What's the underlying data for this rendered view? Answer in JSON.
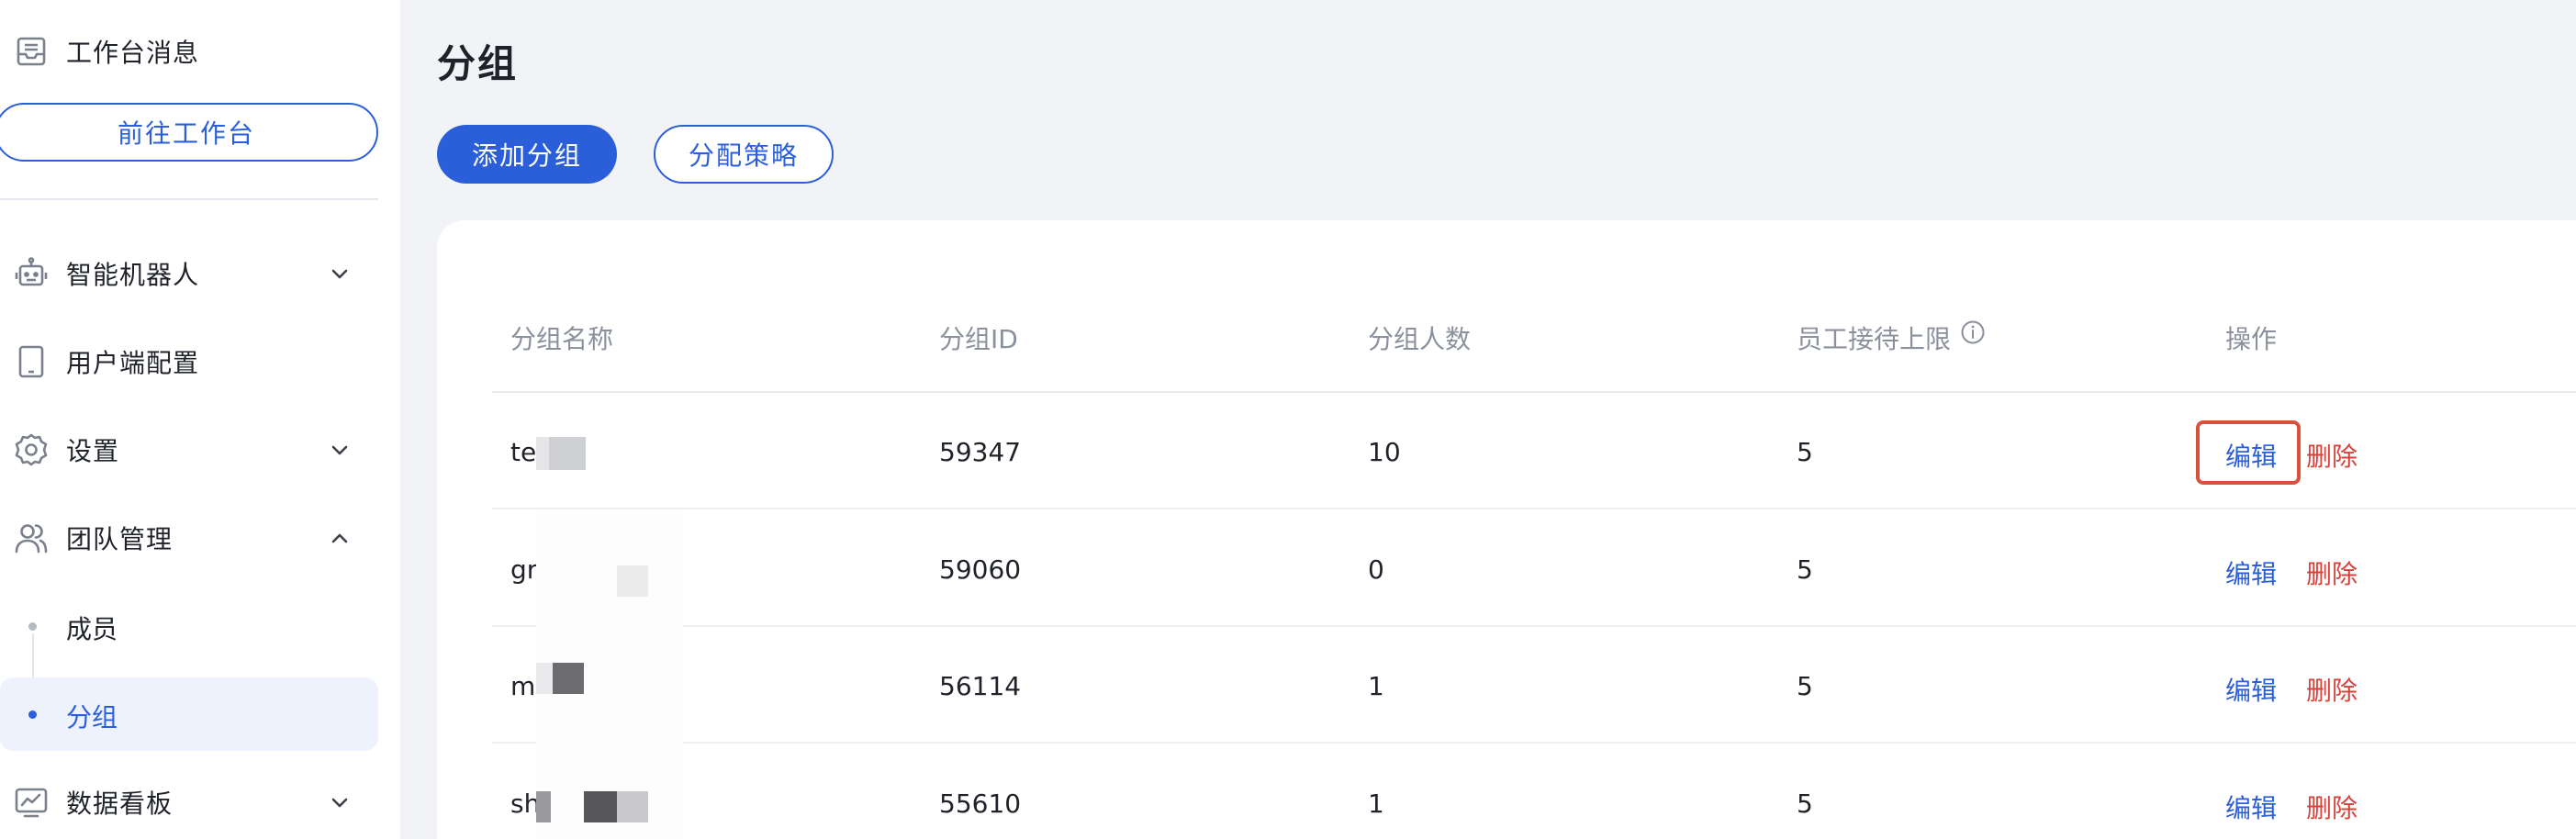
{
  "sidebar": {
    "workspace_messages": "工作台消息",
    "goto_workspace": "前往工作台",
    "items": [
      {
        "label": "智能机器人",
        "icon": "robot-icon",
        "expandable": true,
        "expanded": false
      },
      {
        "label": "用户端配置",
        "icon": "tablet-icon",
        "expandable": false
      },
      {
        "label": "设置",
        "icon": "gear-icon",
        "expandable": true,
        "expanded": false
      },
      {
        "label": "团队管理",
        "icon": "users-icon",
        "expandable": true,
        "expanded": true
      },
      {
        "label": "数据看板",
        "icon": "chart-board-icon",
        "expandable": true,
        "expanded": false
      }
    ],
    "team_sub_items": [
      {
        "label": "成员",
        "active": false
      },
      {
        "label": "分组",
        "active": true
      }
    ]
  },
  "main": {
    "title": "分组",
    "add_group_button": "添加分组",
    "assign_strategy_button": "分配策略"
  },
  "table": {
    "columns": [
      "分组名称",
      "分组ID",
      "分组人数",
      "员工接待上限",
      "操作"
    ],
    "rows": [
      {
        "name": "te",
        "id": "59347",
        "count": "10",
        "limit": "5"
      },
      {
        "name": "gr",
        "id": "59060",
        "count": "0",
        "limit": "5"
      },
      {
        "name": "m",
        "id": "56114",
        "count": "1",
        "limit": "5"
      },
      {
        "name": "sh",
        "id": "55610",
        "count": "1",
        "limit": "5"
      }
    ],
    "actions": {
      "edit": "编辑",
      "delete": "删除"
    }
  },
  "colors": {
    "primary": "#2b5fd9",
    "danger": "#d8423a",
    "highlight": "#d9503b",
    "page_bg": "#f2f3f7"
  }
}
